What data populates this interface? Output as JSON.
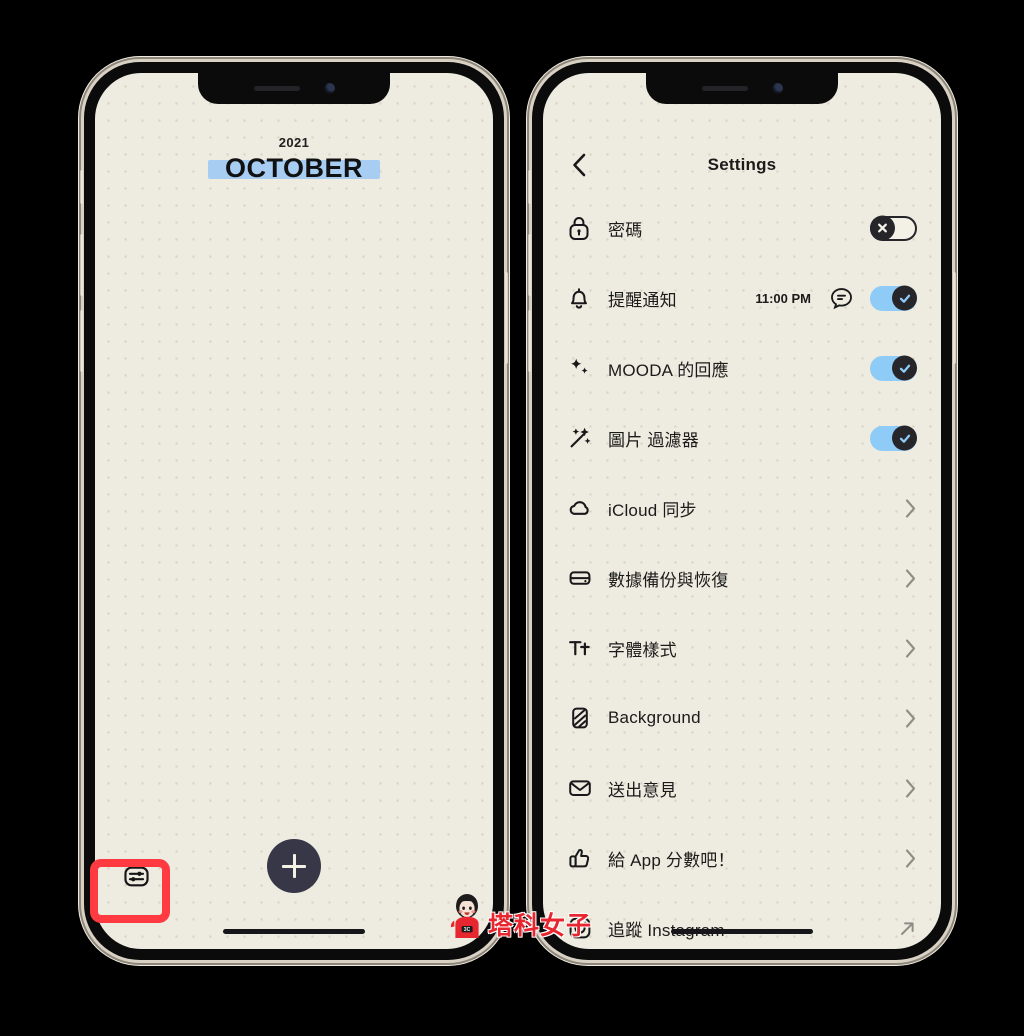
{
  "calendar": {
    "year": "2021",
    "month": "OCTOBER",
    "highlight_color": "#a8cdf2",
    "add_button_label": "+",
    "settings_button_name": "sliders"
  },
  "highlight": {
    "color": "#ff3b41",
    "target": "settings-button"
  },
  "settings": {
    "back_label": "‹",
    "title": "Settings",
    "rows": [
      {
        "icon": "lock-icon",
        "label": "密碼",
        "control": "toggle",
        "state": "off"
      },
      {
        "icon": "bell-icon",
        "label": "提醒通知",
        "control": "toggle",
        "state": "on",
        "value": "11:00 PM",
        "extra_icon": "speech-bubble-icon"
      },
      {
        "icon": "sparkles-icon",
        "label": "MOODA 的回應",
        "control": "toggle",
        "state": "on"
      },
      {
        "icon": "magic-wand-icon",
        "label": "圖片 過濾器",
        "control": "toggle",
        "state": "on"
      },
      {
        "icon": "cloud-icon",
        "label": "iCloud 同步",
        "control": "chevron"
      },
      {
        "icon": "drive-icon",
        "label": "數據備份與恢復",
        "control": "chevron"
      },
      {
        "icon": "text-style-icon",
        "label": "字體樣式",
        "control": "chevron"
      },
      {
        "icon": "background-icon",
        "label": "Background",
        "control": "chevron"
      },
      {
        "icon": "mail-icon",
        "label": "送出意見",
        "control": "chevron"
      },
      {
        "icon": "thumbs-up-icon",
        "label": "給 App 分數吧！",
        "control": "chevron"
      },
      {
        "icon": "instagram-icon",
        "label": "追蹤 Instagram",
        "control": "external"
      }
    ]
  },
  "watermark": {
    "text": "塔科女子",
    "color": "#e8262f"
  }
}
